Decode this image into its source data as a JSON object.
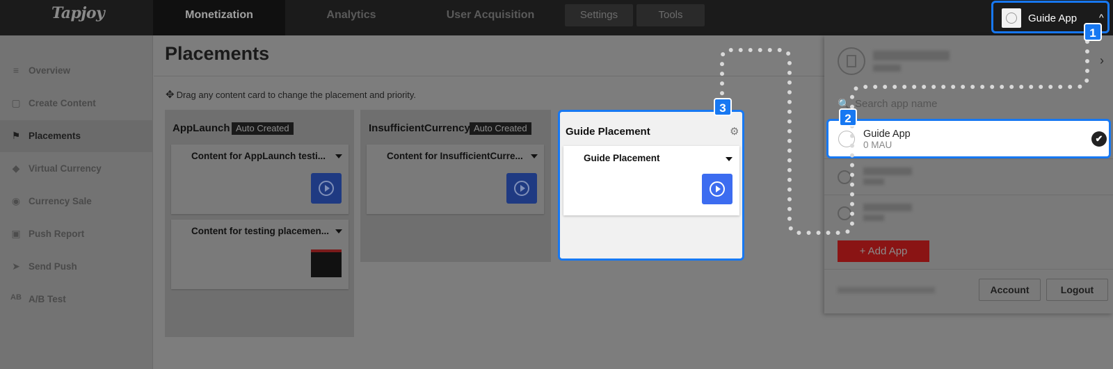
{
  "topnav": {
    "logo": "Tapjoy",
    "tabs": [
      {
        "label": "Monetization"
      },
      {
        "label": "Analytics"
      },
      {
        "label": "User Acquisition"
      }
    ],
    "small": [
      {
        "label": "Settings"
      },
      {
        "label": "Tools"
      }
    ],
    "app_switcher": {
      "name": "Guide App",
      "apple": "",
      "chevron": "^"
    }
  },
  "badges": {
    "one": "1",
    "two": "2",
    "three": "3"
  },
  "sidebar": {
    "items": [
      {
        "label": "Overview",
        "icon": "≡"
      },
      {
        "label": "Create Content",
        "icon": "▢"
      },
      {
        "label": "Placements",
        "icon": "⚑"
      },
      {
        "label": "Virtual Currency",
        "icon": "◆"
      },
      {
        "label": "Currency Sale",
        "icon": "◉"
      },
      {
        "label": "Push Report",
        "icon": "▣"
      },
      {
        "label": "Send Push",
        "icon": "➤"
      },
      {
        "label": "A/B Test",
        "icon": "AB"
      }
    ]
  },
  "main": {
    "title": "Placements",
    "drag_icon": "✥",
    "drag_hint": "Drag any content card to change the placement and priority.",
    "columns": [
      {
        "title": "AppLaunch",
        "tag": "Auto Created",
        "cards": [
          {
            "title": "Content for AppLaunch testi..."
          },
          {
            "title": "Content for testing placemen..."
          }
        ]
      },
      {
        "title": "InsufficientCurrency",
        "tag": "Auto Created",
        "cards": [
          {
            "title": "Content for InsufficientCurre..."
          }
        ]
      },
      {
        "title": "Guide Placement",
        "cards": [
          {
            "title": "Guide Placement"
          }
        ]
      }
    ]
  },
  "panel": {
    "search_placeholder": "Search app name",
    "selected_app": {
      "name": "Guide App",
      "mau": "0 MAU"
    },
    "add_app": "+ Add App",
    "account": "Account",
    "logout": "Logout"
  },
  "icons": {
    "apple": "",
    "gear": "⚙",
    "check": "✔",
    "search": "🔍",
    "chevron_right": "›"
  },
  "colors": {
    "highlight": "#1778f2",
    "add_app": "#d32f2f",
    "play": "#3c6cf0"
  }
}
